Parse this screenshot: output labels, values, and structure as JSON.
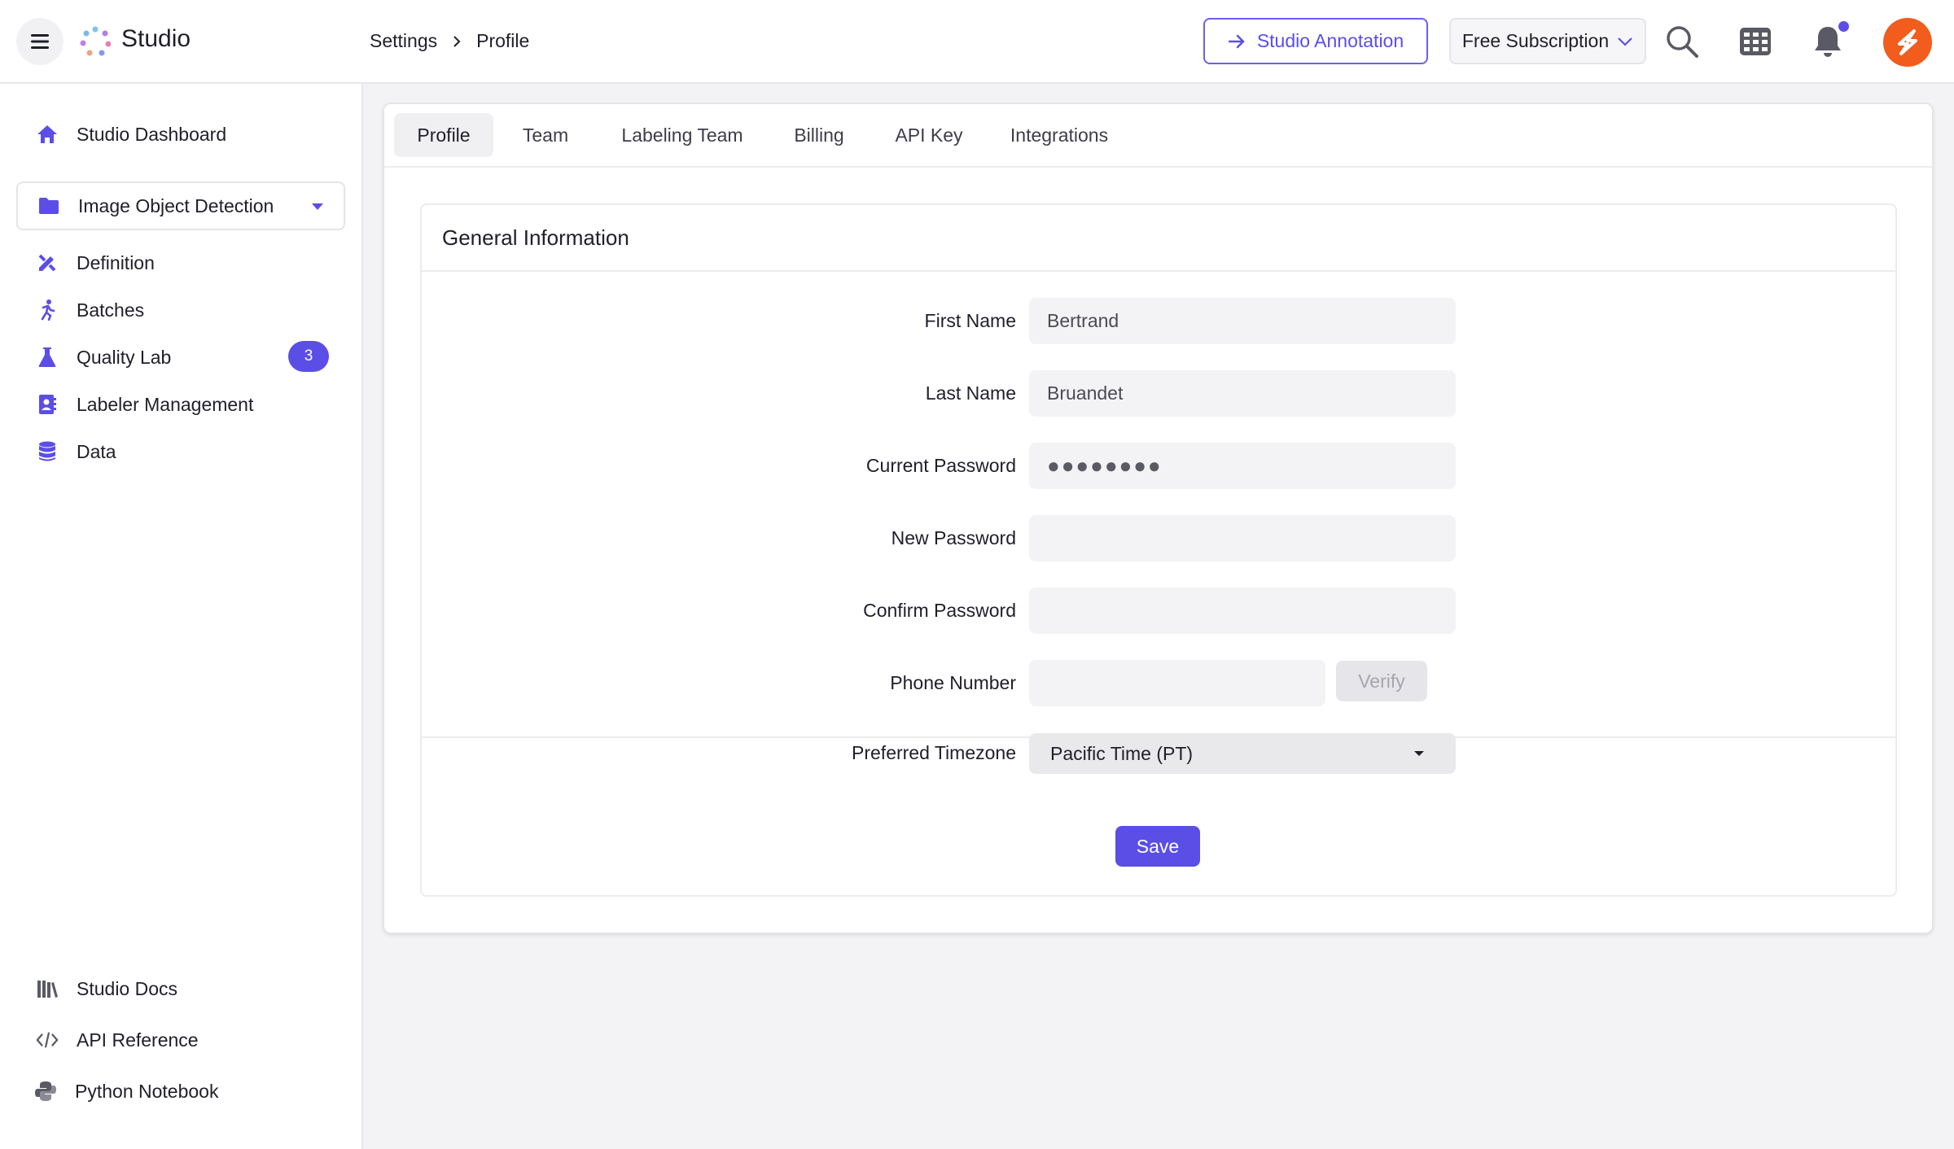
{
  "header": {
    "app_title": "Studio",
    "breadcrumb": [
      "Settings",
      "Profile"
    ],
    "annotation_button": "Studio Annotation",
    "subscription": "Free Subscription",
    "notification_dot": true
  },
  "sidebar": {
    "items": [
      {
        "label": "Studio Dashboard",
        "icon": "home-icon"
      },
      {
        "label": "Image Object Detection",
        "icon": "folder-icon"
      },
      {
        "label": "Definition",
        "icon": "pencil-ruler-icon"
      },
      {
        "label": "Batches",
        "icon": "running-person-icon"
      },
      {
        "label": "Quality Lab",
        "icon": "flask-icon",
        "badge": "3"
      },
      {
        "label": "Labeler Management",
        "icon": "contact-book-icon"
      },
      {
        "label": "Data",
        "icon": "database-icon"
      }
    ],
    "footer": [
      {
        "label": "Studio Docs",
        "icon": "books-icon"
      },
      {
        "label": "API Reference",
        "icon": "code-icon"
      },
      {
        "label": "Python Notebook",
        "icon": "python-icon"
      }
    ]
  },
  "tabs": [
    "Profile",
    "Team",
    "Labeling Team",
    "Billing",
    "API Key",
    "Integrations"
  ],
  "active_tab": "Profile",
  "form": {
    "title": "General Information",
    "first_name_label": "First Name",
    "first_name": "Bertrand",
    "last_name_label": "Last Name",
    "last_name": "Bruandet",
    "current_password_label": "Current Password",
    "current_password": "●●●●●●●●",
    "new_password_label": "New Password",
    "new_password": "",
    "confirm_password_label": "Confirm Password",
    "confirm_password": "",
    "phone_label": "Phone Number",
    "phone": "",
    "verify_button": "Verify",
    "timezone_label": "Preferred Timezone",
    "timezone": "Pacific Time (PT)",
    "save_button": "Save"
  },
  "colors": {
    "accent": "#5b4ee6",
    "avatar": "#f25c1c"
  }
}
